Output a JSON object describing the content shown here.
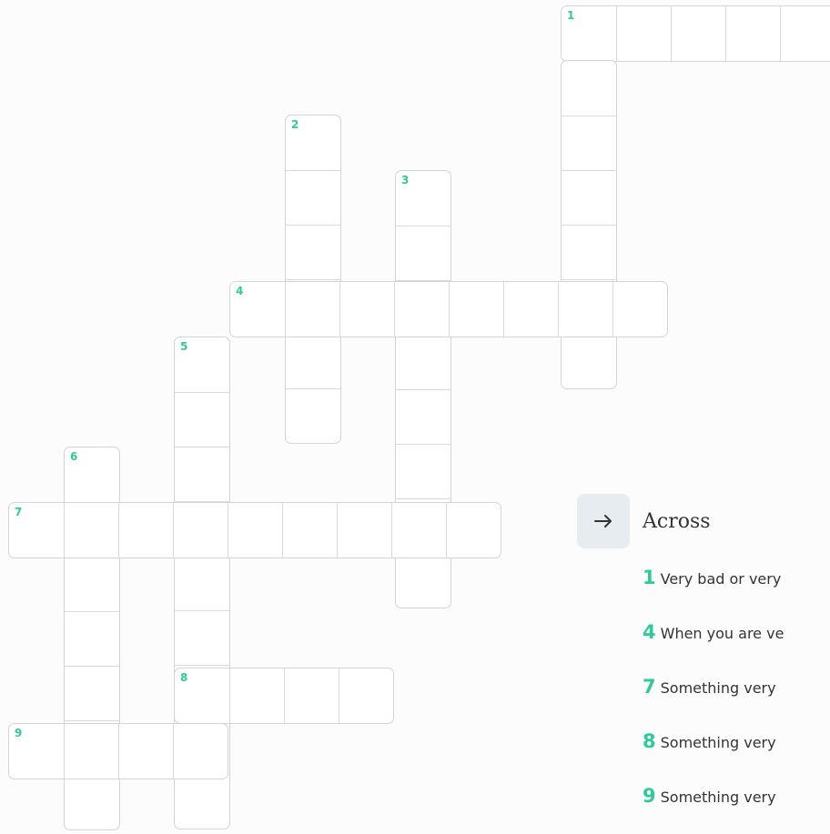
{
  "clues_panel": {
    "direction_icon": "arrow-right-icon",
    "heading": "Across",
    "accent_color": "#2fc99a"
  },
  "across_clues": [
    {
      "number": "1",
      "text": "Very bad or very"
    },
    {
      "number": "4",
      "text": "When you are ve"
    },
    {
      "number": "7",
      "text": "Something very"
    },
    {
      "number": "8",
      "text": "Something very"
    },
    {
      "number": "9",
      "text": "Something very"
    }
  ],
  "grid_numbers": [
    "1",
    "2",
    "3",
    "4",
    "5",
    "6",
    "7",
    "8",
    "9"
  ]
}
